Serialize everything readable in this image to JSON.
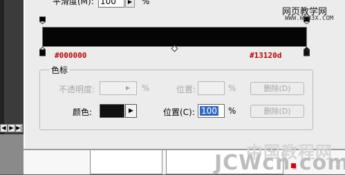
{
  "gradient_editor": {
    "smoothness_label": "平滑度(M):",
    "smoothness_value": "100",
    "smoothness_unit": "%",
    "left_stop_color": "#000000",
    "right_stop_color": "#13120d",
    "stops_group_title": "色标",
    "opacity_label": "不透明度:",
    "opacity_unit": "%",
    "opacity_location_label": "位置:",
    "opacity_location_unit": "%",
    "opacity_delete_button": "删除(D)",
    "color_label": "颜色:",
    "color_location_label": "位置(C):",
    "color_location_value": "100",
    "color_location_unit": "%",
    "color_delete_button": "删除(D)",
    "swatch_color": "#111111"
  },
  "left_panel": {
    "nav_prev": "◀",
    "nav_next": "▶",
    "nav_last": "▶|"
  },
  "watermarks": {
    "top": "网页教学网",
    "top_url": "WWW.WEB3X.COM",
    "cn": "中国教程网",
    "jc": "JCWcn.com"
  },
  "colors": {
    "accent_red": "#c00000",
    "selection_blue": "#316ac5"
  }
}
